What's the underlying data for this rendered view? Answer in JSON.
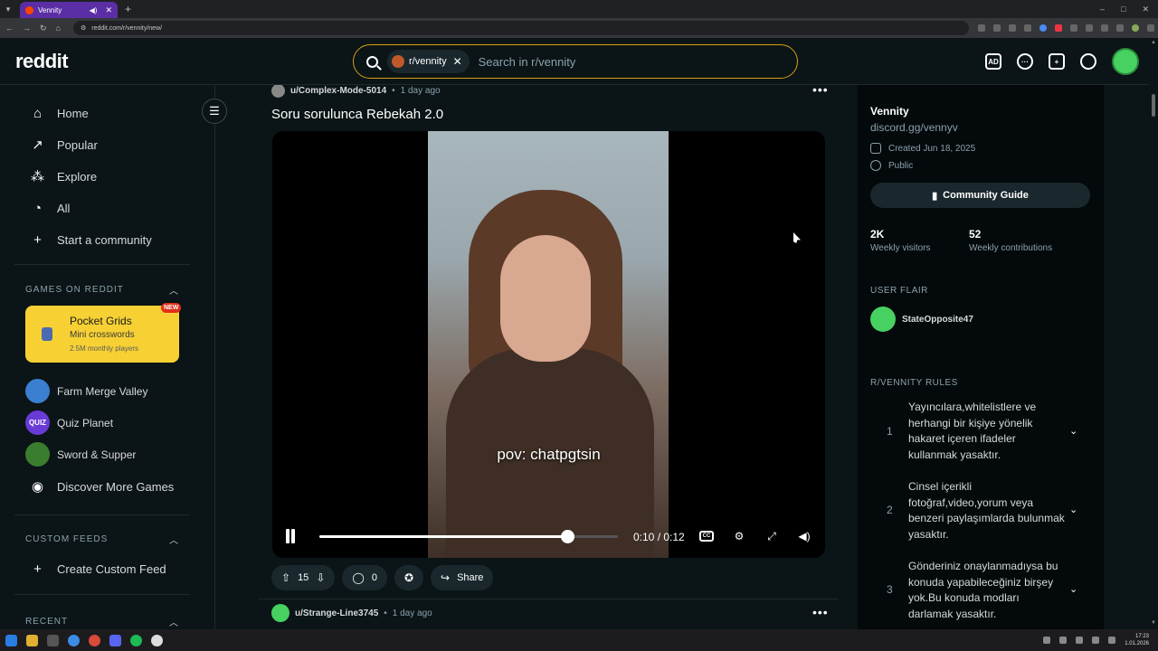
{
  "browser": {
    "tab_title": "Vennity",
    "url": "reddit.com/r/vennity/new/",
    "new_tab": "+",
    "window_controls": [
      "–",
      "□",
      "✕"
    ]
  },
  "header": {
    "logo": "reddit",
    "search_chip": "r/vennity",
    "search_placeholder": "Search in r/vennity"
  },
  "sidebar": {
    "nav": [
      {
        "label": "Home",
        "icon": "home-icon"
      },
      {
        "label": "Popular",
        "icon": "popular-icon"
      },
      {
        "label": "Explore",
        "icon": "explore-icon"
      },
      {
        "label": "All",
        "icon": "all-icon"
      },
      {
        "label": "Start a community",
        "icon": "plus-icon"
      }
    ],
    "games_header": "GAMES ON REDDIT",
    "featured_game": {
      "title": "Pocket Grids",
      "subtitle": "Mini crosswords",
      "players": "2.5M monthly players",
      "badge": "NEW"
    },
    "games": [
      "Farm Merge Valley",
      "Quiz Planet",
      "Sword & Supper",
      "Discover More Games"
    ],
    "quiz_badge": "QUIZ",
    "custom_feeds_header": "CUSTOM FEEDS",
    "create_feed": "Create Custom Feed",
    "recent_header": "RECENT"
  },
  "post": {
    "author": "u/Complex-Mode-5014",
    "time": "1 day ago",
    "title": "Soru sorulunca Rebekah 2.0",
    "video_caption": "pov: chatpgtsin",
    "video_time": "0:10 / 0:12",
    "progress": 0.83,
    "votes": "15",
    "comments": "0",
    "share": "Share"
  },
  "next_post": {
    "author": "u/Strange-Line3745",
    "time": "1 day ago"
  },
  "community": {
    "name": "Vennity",
    "discord": "discord.gg/vennyv",
    "created": "Created Jun 18, 2025",
    "visibility": "Public",
    "guide_button": "Community Guide",
    "visitors_value": "2K",
    "visitors_label": "Weekly visitors",
    "contrib_value": "52",
    "contrib_label": "Weekly contributions",
    "flair_header": "USER FLAIR",
    "flair_user": "StateOpposite47",
    "rules_header": "R/VENNITY RULES",
    "rules": [
      {
        "n": "1",
        "text": "Yayıncılara,whitelistlere ve herhangi bir kişiye yönelik hakaret içeren ifadeler kullanmak yasaktır."
      },
      {
        "n": "2",
        "text": "Cinsel içerikli fotoğraf,video,yorum veya benzeri paylaşımlarda bulunmak yasaktır."
      },
      {
        "n": "3",
        "text": "Gönderiniz onaylanmadıysa bu konuda yapabileceğiniz birşey yok.Bu konuda modları darlamak yasaktır."
      }
    ]
  },
  "taskbar": {
    "time": "17:23",
    "date": "1.01.2026"
  }
}
